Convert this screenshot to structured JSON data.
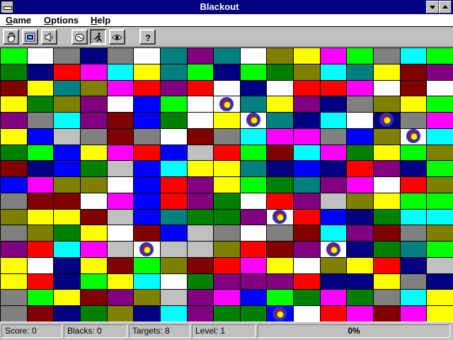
{
  "window": {
    "title": "Blackout"
  },
  "menu": {
    "items": [
      "Game",
      "Options",
      "Help"
    ]
  },
  "toolbar": {
    "buttons": [
      "hand-icon",
      "board-icon",
      "speaker-icon",
      "brain-icon",
      "runner-icon",
      "eye-icon",
      "help-icon"
    ]
  },
  "palette": {
    "G": "#00ff00",
    "W": "#ffffff",
    "Gr": "#808080",
    "N": "#000080",
    "T": "#008080",
    "P": "#800080",
    "O": "#808000",
    "Y": "#ffff00",
    "M": "#ff00ff",
    "D": "#008000",
    "R": "#ff0000",
    "C": "#00ffff",
    "B": "#0000ff",
    "S": "#c0c0c0",
    "Mr": "#800000"
  },
  "board": {
    "rows": [
      [
        "G",
        "W",
        "Gr",
        "N",
        "Gr",
        "W",
        "T",
        "P",
        "T",
        "W",
        "O",
        "Y",
        "M",
        "G",
        "Gr",
        "C",
        "G"
      ],
      [
        "D",
        "N",
        "R",
        "M",
        "C",
        "Y",
        "T",
        "G",
        "N",
        "G",
        "D",
        "O",
        "C",
        "T",
        "Y",
        "Mr",
        "P"
      ],
      [
        "Mr",
        "Y",
        "T",
        "O",
        "M",
        "R",
        "P",
        "R",
        "W",
        "N",
        "W",
        "R",
        "R",
        "M",
        "W",
        "Mr",
        "W"
      ],
      [
        "Y",
        "D",
        "O",
        "P",
        "W",
        "B",
        "G",
        "W",
        "W",
        "T",
        "Y",
        "P",
        "N",
        "Gr",
        "O",
        "Y",
        "G"
      ],
      [
        "P",
        "Gr",
        "C",
        "P",
        "Mr",
        "B",
        "D",
        "W",
        "Y",
        "W",
        "T",
        "N",
        "C",
        "W",
        "N",
        "Gr",
        "M"
      ],
      [
        "Y",
        "B",
        "S",
        "Gr",
        "Mr",
        "Gr",
        "W",
        "Mr",
        "Gr",
        "C",
        "M",
        "M",
        "Gr",
        "B",
        "O",
        "W",
        "C"
      ],
      [
        "D",
        "G",
        "B",
        "Y",
        "M",
        "R",
        "B",
        "S",
        "R",
        "G",
        "Mr",
        "C",
        "M",
        "D",
        "Y",
        "G",
        "O"
      ],
      [
        "Mr",
        "N",
        "B",
        "D",
        "S",
        "B",
        "C",
        "Y",
        "Y",
        "T",
        "N",
        "B",
        "N",
        "R",
        "P",
        "N",
        "G"
      ],
      [
        "B",
        "M",
        "O",
        "O",
        "W",
        "B",
        "R",
        "P",
        "Y",
        "G",
        "D",
        "T",
        "P",
        "M",
        "W",
        "R",
        "O"
      ],
      [
        "Gr",
        "Mr",
        "Mr",
        "W",
        "M",
        "B",
        "R",
        "P",
        "D",
        "W",
        "R",
        "P",
        "S",
        "O",
        "Y",
        "G",
        "G"
      ],
      [
        "O",
        "Y",
        "Y",
        "Mr",
        "S",
        "B",
        "T",
        "D",
        "D",
        "P",
        "W",
        "R",
        "B",
        "N",
        "D",
        "C",
        "C"
      ],
      [
        "Gr",
        "O",
        "D",
        "Y",
        "W",
        "Mr",
        "B",
        "S",
        "Gr",
        "W",
        "Gr",
        "Mr",
        "C",
        "P",
        "Mr",
        "Gr",
        "O"
      ],
      [
        "P",
        "R",
        "C",
        "M",
        "S",
        "W",
        "S",
        "S",
        "O",
        "R",
        "Mr",
        "P",
        "W",
        "N",
        "D",
        "T",
        "G"
      ],
      [
        "Y",
        "W",
        "N",
        "Y",
        "Mr",
        "G",
        "O",
        "Mr",
        "R",
        "M",
        "Y",
        "W",
        "O",
        "Y",
        "R",
        "N",
        "S"
      ],
      [
        "Y",
        "R",
        "N",
        "G",
        "Y",
        "C",
        "W",
        "D",
        "P",
        "P",
        "P",
        "R",
        "N",
        "N",
        "Y",
        "Gr",
        "N"
      ],
      [
        "Gr",
        "G",
        "Y",
        "Mr",
        "P",
        "O",
        "S",
        "P",
        "M",
        "B",
        "G",
        "D",
        "M",
        "D",
        "Gr",
        "C",
        "Y"
      ],
      [
        "Gr",
        "Mr",
        "N",
        "D",
        "O",
        "N",
        "C",
        "P",
        "D",
        "D",
        "B",
        "W",
        "R",
        "M",
        "Mr",
        "M",
        "Y"
      ]
    ],
    "targets": [
      [
        3,
        8
      ],
      [
        4,
        9
      ],
      [
        4,
        14
      ],
      [
        5,
        15
      ],
      [
        10,
        10
      ],
      [
        12,
        5
      ],
      [
        12,
        12
      ],
      [
        16,
        10
      ]
    ]
  },
  "status": {
    "score": "Score: 0",
    "blacks": "Blacks: 0",
    "targets": "Targets: 8",
    "level": "Level: 1",
    "progress_text": "0%",
    "progress_value": 0
  }
}
